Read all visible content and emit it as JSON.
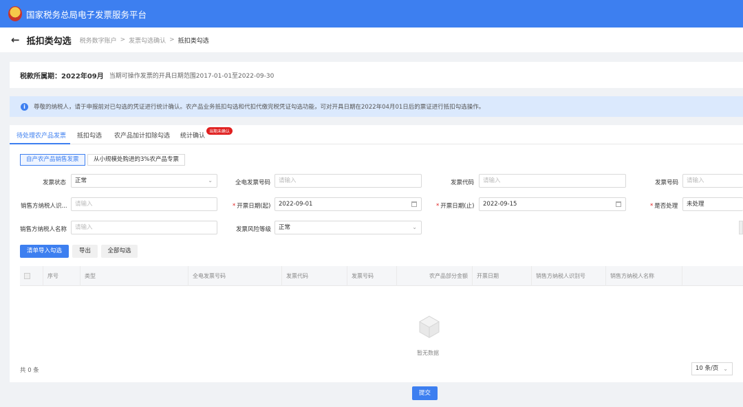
{
  "app": {
    "title": "国家税务总局电子发票服务平台"
  },
  "header": {
    "back_icon": "arrow-left-icon",
    "page_title": "抵扣类勾选",
    "breadcrumb": [
      "税务数字账户",
      "发票勾选确认",
      "抵扣类勾选"
    ],
    "separator": ">"
  },
  "period": {
    "label": "税款所属期：",
    "value": "2022年09月",
    "range_text": "当期可操作发票的开具日期范围2017-01-01至2022-09-30"
  },
  "notice": {
    "icon": "info-icon",
    "text": "尊敬的纳税人，请于申报前对已勾选的凭证进行统计确认。农产品业务抵扣勾选和代扣代缴完税凭证勾选功能，可对开具日期在2022年04月01日后的票证进行抵扣勾选操作。"
  },
  "tabs": [
    {
      "label": "待处理农产品发票",
      "active": true
    },
    {
      "label": "抵扣勾选",
      "active": false
    },
    {
      "label": "农产品加计扣除勾选",
      "active": false
    },
    {
      "label": "统计确认",
      "active": false
    }
  ],
  "tab_badge": "当期未确认",
  "subtabs": [
    {
      "label": "自产农产品销售发票",
      "active": true
    },
    {
      "label": "从小规模处购进的3%农产品专票",
      "active": false
    }
  ],
  "filters": {
    "invoice_status": {
      "label": "发票状态",
      "value": "正常"
    },
    "full_invoice_no": {
      "label": "全电发票号码",
      "placeholder": "请输入"
    },
    "invoice_code": {
      "label": "发票代码",
      "placeholder": "请输入"
    },
    "invoice_no": {
      "label": "发票号码",
      "placeholder": "请输入"
    },
    "seller_tax_id": {
      "label": "销售方纳税人识...",
      "placeholder": "请输入"
    },
    "date_start": {
      "label": "开票日期(起)",
      "value": "2022-09-01"
    },
    "date_end": {
      "label": "开票日期(止)",
      "value": "2022-09-15"
    },
    "processed": {
      "label": "是否处理",
      "value": "未处理"
    },
    "seller_name": {
      "label": "销售方纳税人名称",
      "placeholder": "请输入"
    },
    "risk_level": {
      "label": "发票风险等级",
      "value": "正常"
    }
  },
  "actions": {
    "import_select": "清单导入勾选",
    "export": "导出",
    "select_all": "全部勾选"
  },
  "table": {
    "columns": [
      "序号",
      "类型",
      "全电发票号码",
      "发票代码",
      "发票号码",
      "农产品部分金额",
      "开票日期",
      "销售方纳税人识别号",
      "销售方纳税人名称"
    ],
    "rows": [],
    "empty_text": "暂无数据"
  },
  "pagination": {
    "total_text": "共 0 条",
    "page_size": "10 条/页"
  },
  "submit_label": "提交",
  "colors": {
    "primary": "#3d7ff0",
    "badge": "#e02020",
    "notice_bg": "#dbe9fd"
  }
}
